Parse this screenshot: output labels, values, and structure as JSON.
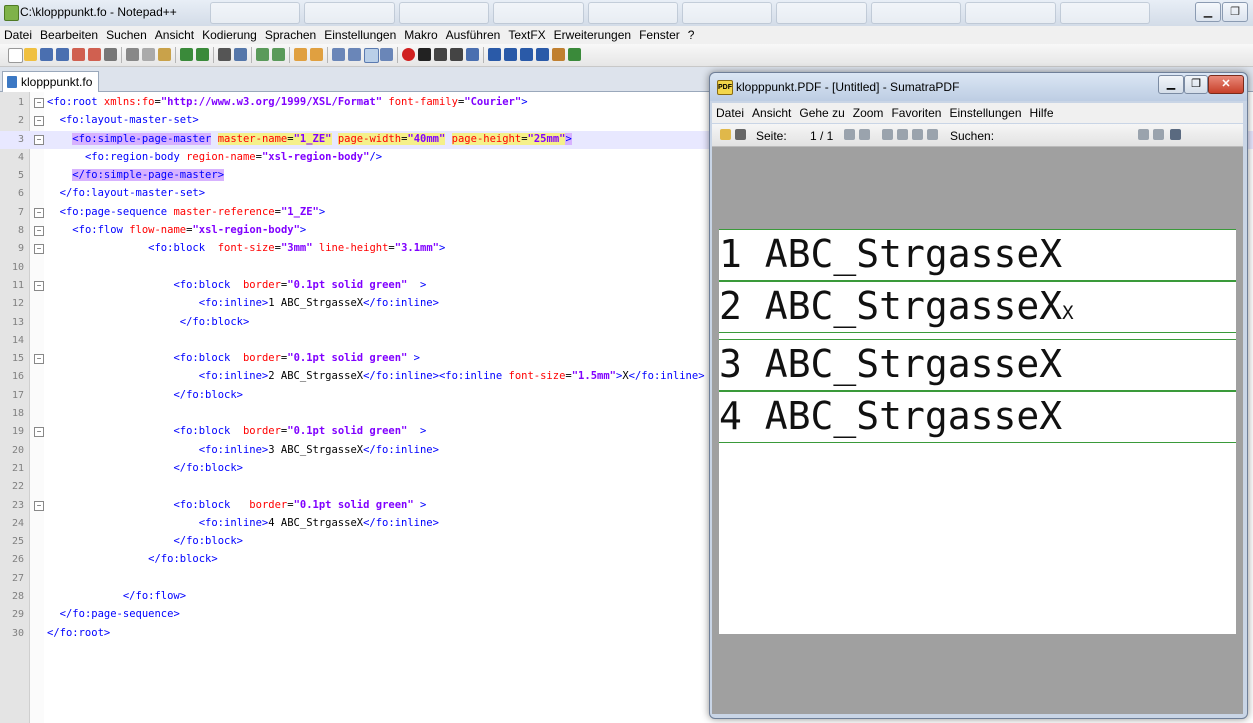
{
  "window": {
    "title": "C:\\klopppunkt.fo - Notepad++"
  },
  "menu": [
    "Datei",
    "Bearbeiten",
    "Suchen",
    "Ansicht",
    "Kodierung",
    "Sprachen",
    "Einstellungen",
    "Makro",
    "Ausführen",
    "TextFX",
    "Erweiterungen",
    "Fenster",
    "?"
  ],
  "tab": {
    "label": "klopppunkt.fo"
  },
  "code_lines": [
    {
      "n": "1",
      "fold": "−",
      "segs": [
        [
          "t",
          "<fo:root "
        ],
        [
          "a",
          "xmlns:fo"
        ],
        [
          "x",
          "="
        ],
        [
          "v",
          "\"http://www.w3.org/1999/XSL/Format\""
        ],
        [
          "x",
          " "
        ],
        [
          "a",
          "font-family"
        ],
        [
          "x",
          "="
        ],
        [
          "v",
          "\"Courier\""
        ],
        [
          "t",
          ">"
        ]
      ]
    },
    {
      "n": "2",
      "fold": "−",
      "segs": [
        [
          "x",
          "  "
        ],
        [
          "t",
          "<fo:layout-master-set>"
        ]
      ]
    },
    {
      "n": "3",
      "fold": "−",
      "hl": true,
      "segs": [
        [
          "x",
          "    "
        ],
        [
          "tm",
          "<fo:simple-page-master"
        ],
        [
          "x",
          " "
        ],
        [
          "am",
          "master-name"
        ],
        [
          "xm",
          "="
        ],
        [
          "vm",
          "\"1_ZE\""
        ],
        [
          "x",
          " "
        ],
        [
          "am",
          "page-width"
        ],
        [
          "xm",
          "="
        ],
        [
          "vm",
          "\"40mm\""
        ],
        [
          "x",
          " "
        ],
        [
          "am",
          "page-height"
        ],
        [
          "xm",
          "="
        ],
        [
          "vm",
          "\"25mm\""
        ],
        [
          "tm",
          ">"
        ]
      ]
    },
    {
      "n": "4",
      "fold": "",
      "segs": [
        [
          "x",
          "      "
        ],
        [
          "t",
          "<fo:region-body "
        ],
        [
          "a",
          "region-name"
        ],
        [
          "x",
          "="
        ],
        [
          "v",
          "\"xsl-region-body\""
        ],
        [
          "t",
          "/>"
        ]
      ]
    },
    {
      "n": "5",
      "fold": "",
      "segs": [
        [
          "x",
          "    "
        ],
        [
          "tm",
          "</fo:simple-page-master>"
        ]
      ]
    },
    {
      "n": "6",
      "fold": "",
      "segs": [
        [
          "x",
          "  "
        ],
        [
          "t",
          "</fo:layout-master-set>"
        ]
      ]
    },
    {
      "n": "7",
      "fold": "−",
      "segs": [
        [
          "x",
          "  "
        ],
        [
          "t",
          "<fo:page-sequence "
        ],
        [
          "a",
          "master-reference"
        ],
        [
          "x",
          "="
        ],
        [
          "v",
          "\"1_ZE\""
        ],
        [
          "t",
          ">"
        ]
      ]
    },
    {
      "n": "8",
      "fold": "−",
      "segs": [
        [
          "x",
          "    "
        ],
        [
          "t",
          "<fo:flow "
        ],
        [
          "a",
          "flow-name"
        ],
        [
          "x",
          "="
        ],
        [
          "v",
          "\"xsl-region-body\""
        ],
        [
          "t",
          ">"
        ]
      ]
    },
    {
      "n": "9",
      "fold": "−",
      "segs": [
        [
          "x",
          "                "
        ],
        [
          "t",
          "<fo:block  "
        ],
        [
          "a",
          "font-size"
        ],
        [
          "x",
          "="
        ],
        [
          "v",
          "\"3mm\""
        ],
        [
          "x",
          " "
        ],
        [
          "a",
          "line-height"
        ],
        [
          "x",
          "="
        ],
        [
          "v",
          "\"3.1mm\""
        ],
        [
          "t",
          ">"
        ]
      ]
    },
    {
      "n": "10",
      "fold": "",
      "segs": []
    },
    {
      "n": "11",
      "fold": "−",
      "segs": [
        [
          "x",
          "                    "
        ],
        [
          "t",
          "<fo:block  "
        ],
        [
          "a",
          "border"
        ],
        [
          "x",
          "="
        ],
        [
          "v",
          "\"0.1pt solid green\""
        ],
        [
          "t",
          "  >"
        ]
      ]
    },
    {
      "n": "12",
      "fold": "",
      "segs": [
        [
          "x",
          "                        "
        ],
        [
          "t",
          "<fo:inline>"
        ],
        [
          "x",
          "1 ABC_StrgasseX"
        ],
        [
          "t",
          "</fo:inline>"
        ]
      ]
    },
    {
      "n": "13",
      "fold": "",
      "segs": [
        [
          "x",
          "                     "
        ],
        [
          "t",
          "</fo:block>"
        ]
      ]
    },
    {
      "n": "14",
      "fold": "",
      "segs": []
    },
    {
      "n": "15",
      "fold": "−",
      "segs": [
        [
          "x",
          "                    "
        ],
        [
          "t",
          "<fo:block  "
        ],
        [
          "a",
          "border"
        ],
        [
          "x",
          "="
        ],
        [
          "v",
          "\"0.1pt solid green\""
        ],
        [
          "t",
          " >"
        ]
      ]
    },
    {
      "n": "16",
      "fold": "",
      "segs": [
        [
          "x",
          "                        "
        ],
        [
          "t",
          "<fo:inline>"
        ],
        [
          "x",
          "2 ABC_StrgasseX"
        ],
        [
          "t",
          "</fo:inline><fo:inline "
        ],
        [
          "a",
          "font-size"
        ],
        [
          "x",
          "="
        ],
        [
          "v",
          "\"1.5mm\""
        ],
        [
          "t",
          ">"
        ],
        [
          "x",
          "X"
        ],
        [
          "t",
          "</fo:inline>"
        ]
      ]
    },
    {
      "n": "17",
      "fold": "",
      "segs": [
        [
          "x",
          "                    "
        ],
        [
          "t",
          "</fo:block>"
        ]
      ]
    },
    {
      "n": "18",
      "fold": "",
      "segs": []
    },
    {
      "n": "19",
      "fold": "−",
      "segs": [
        [
          "x",
          "                    "
        ],
        [
          "t",
          "<fo:block  "
        ],
        [
          "a",
          "border"
        ],
        [
          "x",
          "="
        ],
        [
          "v",
          "\"0.1pt solid green\""
        ],
        [
          "t",
          "  >"
        ]
      ]
    },
    {
      "n": "20",
      "fold": "",
      "segs": [
        [
          "x",
          "                        "
        ],
        [
          "t",
          "<fo:inline>"
        ],
        [
          "x",
          "3 ABC_StrgasseX"
        ],
        [
          "t",
          "</fo:inline>"
        ]
      ]
    },
    {
      "n": "21",
      "fold": "",
      "segs": [
        [
          "x",
          "                    "
        ],
        [
          "t",
          "</fo:block>"
        ]
      ]
    },
    {
      "n": "22",
      "fold": "",
      "segs": []
    },
    {
      "n": "23",
      "fold": "−",
      "segs": [
        [
          "x",
          "                    "
        ],
        [
          "t",
          "<fo:block   "
        ],
        [
          "a",
          "border"
        ],
        [
          "x",
          "="
        ],
        [
          "v",
          "\"0.1pt solid green\""
        ],
        [
          "t",
          " >"
        ]
      ]
    },
    {
      "n": "24",
      "fold": "",
      "segs": [
        [
          "x",
          "                        "
        ],
        [
          "t",
          "<fo:inline>"
        ],
        [
          "x",
          "4 ABC_StrgasseX"
        ],
        [
          "t",
          "</fo:inline>"
        ]
      ]
    },
    {
      "n": "25",
      "fold": "",
      "segs": [
        [
          "x",
          "                    "
        ],
        [
          "t",
          "</fo:block>"
        ]
      ]
    },
    {
      "n": "26",
      "fold": "",
      "segs": [
        [
          "x",
          "                "
        ],
        [
          "t",
          "</fo:block>"
        ]
      ]
    },
    {
      "n": "27",
      "fold": "",
      "segs": []
    },
    {
      "n": "28",
      "fold": "",
      "segs": [
        [
          "x",
          "            "
        ],
        [
          "t",
          "</fo:flow>"
        ]
      ]
    },
    {
      "n": "29",
      "fold": "",
      "segs": [
        [
          "x",
          "  "
        ],
        [
          "t",
          "</fo:page-sequence>"
        ]
      ]
    },
    {
      "n": "30",
      "fold": "",
      "segs": [
        [
          "t",
          "</fo:root>"
        ]
      ]
    }
  ],
  "sumatra": {
    "title": "klopppunkt.PDF - [Untitled] - SumatraPDF",
    "menu": [
      "Datei",
      "Ansicht",
      "Gehe zu",
      "Zoom",
      "Favoriten",
      "Einstellungen",
      "Hilfe"
    ],
    "page_label": "Seite:",
    "page_value": "1 / 1",
    "search_label": "Suchen:",
    "pdf_lines": [
      {
        "text": "1 ABC_StrgasseX",
        "small": ""
      },
      {
        "text": "2 ABC_StrgasseX",
        "small": "X"
      },
      {
        "text": "3 ABC_StrgasseX",
        "small": ""
      },
      {
        "text": "4 ABC_StrgasseX",
        "small": ""
      }
    ]
  },
  "colors": {
    "tag": "#0000ff",
    "attribute": "#ff0000",
    "value": "#8000ff",
    "border_green": "#3a9a3a"
  },
  "icons": [
    "notepadpp-icon",
    "minimize-icon",
    "restore-icon",
    "close-icon",
    "sumatra-icon",
    "file-icon"
  ]
}
